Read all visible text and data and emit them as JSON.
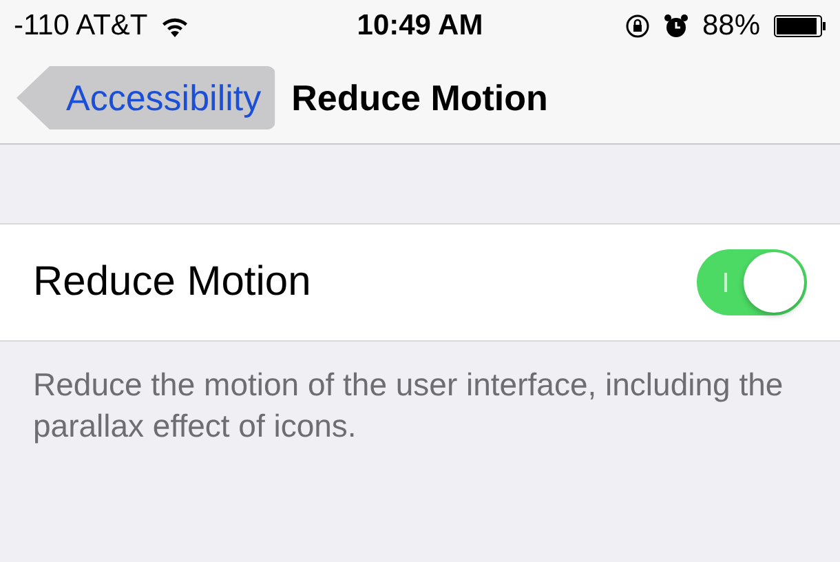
{
  "status_bar": {
    "carrier": "-110 AT&T",
    "time": "10:49 AM",
    "battery": "88%"
  },
  "nav_bar": {
    "back": {
      "label": "Accessibility",
      "highlighted": true
    },
    "title": "Reduce Motion"
  },
  "settings": [
    {
      "label": "Reduce Motion",
      "on": true
    }
  ],
  "footer": "Reduce the motion of the user interface, including the parallax effect of icons."
}
